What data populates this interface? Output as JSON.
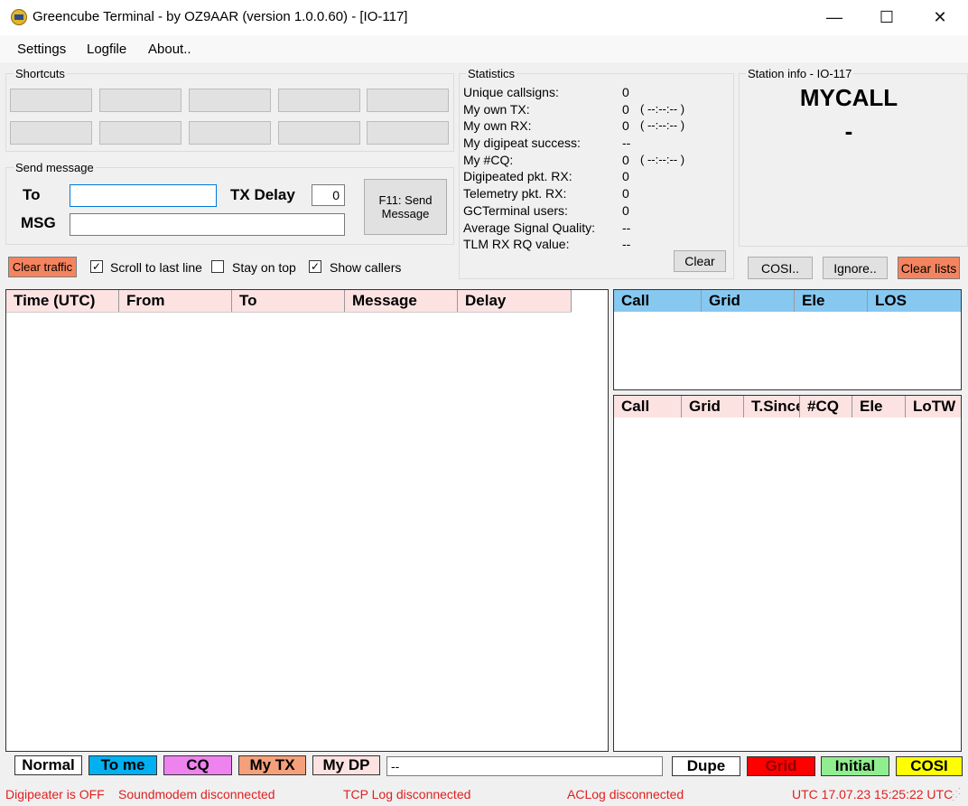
{
  "window": {
    "title": "Greencube Terminal - by OZ9AAR (version 1.0.0.60) - [IO-117]",
    "controls": {
      "minimize": "—",
      "maximize": "☐",
      "close": "✕"
    }
  },
  "menu": {
    "settings": "Settings",
    "logfile": "Logfile",
    "about": "About.."
  },
  "shortcuts": {
    "legend": "Shortcuts"
  },
  "send_message": {
    "legend": "Send message",
    "to_label": "To",
    "to_value": "",
    "msg_label": "MSG",
    "msg_value": "",
    "tx_delay_label": "TX Delay",
    "tx_delay_value": "0",
    "send_button": "F11: Send Message"
  },
  "controls_row": {
    "clear_traffic": "Clear traffic",
    "scroll_to_last_line": {
      "label": "Scroll to last line",
      "checked": true,
      "mark": "✓"
    },
    "stay_on_top": {
      "label": "Stay on top",
      "checked": false,
      "mark": ""
    },
    "show_callers": {
      "label": "Show callers",
      "checked": true,
      "mark": "✓"
    }
  },
  "statistics": {
    "legend": "Statistics",
    "rows": [
      {
        "label": "Unique callsigns:",
        "value": "0",
        "extra": ""
      },
      {
        "label": "My own TX:",
        "value": "0",
        "extra": "( --:--:-- )"
      },
      {
        "label": "My own RX:",
        "value": "0",
        "extra": "( --:--:-- )"
      },
      {
        "label": "My digipeat success:",
        "value": "--",
        "extra": ""
      },
      {
        "label": "My #CQ:",
        "value": "0",
        "extra": "( --:--:-- )"
      },
      {
        "label": "Digipeated pkt. RX:",
        "value": "0",
        "extra": ""
      },
      {
        "label": "Telemetry pkt. RX:",
        "value": "0",
        "extra": ""
      },
      {
        "label": "GCTerminal users:",
        "value": "0",
        "extra": ""
      },
      {
        "label": "Average Signal Quality:",
        "value": "--",
        "extra": ""
      },
      {
        "label": "TLM RX RQ value:",
        "value": "--",
        "extra": ""
      }
    ],
    "clear_button": "Clear"
  },
  "station_info": {
    "legend": "Station info - IO-117",
    "callsign": "MYCALL",
    "grid": "-",
    "cosi_button": "COSI..",
    "ignore_button": "Ignore..",
    "clear_lists_button": "Clear lists"
  },
  "traffic_table": {
    "columns": [
      "Time (UTC)",
      "From",
      "To",
      "Message",
      "Delay"
    ],
    "header_color": "#fde2e2"
  },
  "calls_table": {
    "columns": [
      "Call",
      "Grid",
      "Ele",
      "LOS"
    ],
    "header_color": "#87c8f0"
  },
  "callers_table": {
    "columns": [
      "Call",
      "Grid",
      "T.Since",
      "#CQ",
      "Ele",
      "LoTW"
    ],
    "header_color": "#fde2e2"
  },
  "legend_bar": {
    "normal": "Normal",
    "to_me": "To me",
    "cq": "CQ",
    "my_tx": "My TX",
    "my_dp": "My DP",
    "info_field": "--",
    "dupe": "Dupe",
    "grid": "Grid",
    "initial": "Initial",
    "cosi": "COSI",
    "colors": {
      "normal": "#ffffff",
      "to_me": "#00b0f0",
      "cq": "#ee82ee",
      "my_tx": "#f4a07a",
      "my_dp": "#fde2e2",
      "dupe": "#ffffff",
      "grid": "#ff0000",
      "initial": "#90ee90",
      "cosi": "#ffff00"
    }
  },
  "status_bar": {
    "digipeater": "Digipeater is OFF",
    "soundmodem": "Soundmodem disconnected",
    "tcp_log": "TCP Log disconnected",
    "aclog": "ACLog disconnected",
    "utc": "UTC 17.07.23 15:25:22 UTC"
  }
}
